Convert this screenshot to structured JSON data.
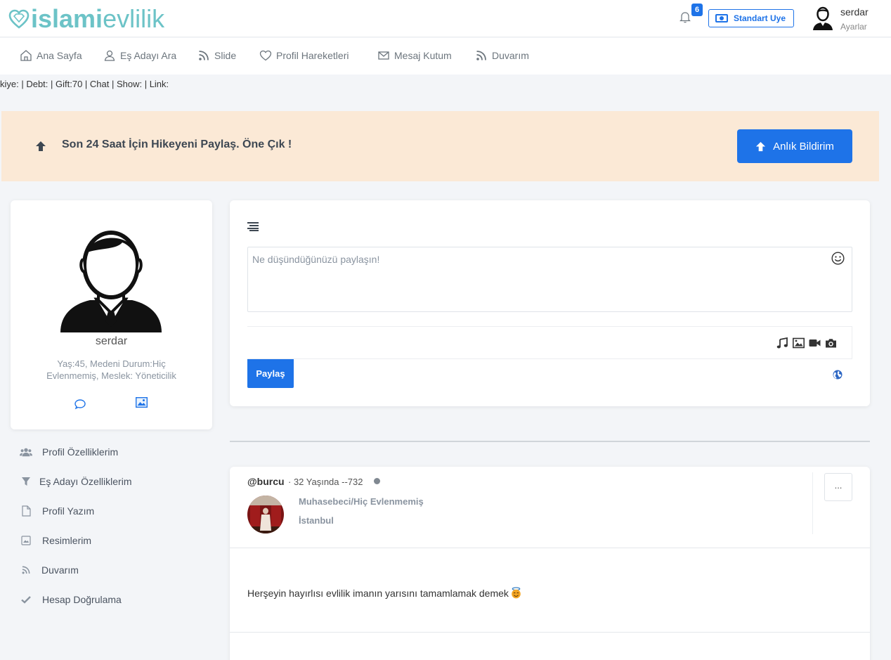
{
  "header": {
    "logo_bold": "islami",
    "logo_light": "evlilik",
    "notification_count": "6",
    "membership_label": "Standart Uye",
    "user_name": "serdar",
    "settings_label": "Ayarlar"
  },
  "nav": {
    "items": [
      {
        "label": "Ana Sayfa",
        "icon": "home-icon"
      },
      {
        "label": "Eş Adayı Ara",
        "icon": "user-icon"
      },
      {
        "label": "Slide",
        "icon": "rss-icon"
      },
      {
        "label": "Profil Hareketleri",
        "icon": "heart-icon"
      },
      {
        "label": "Mesaj Kutum",
        "icon": "envelope-icon"
      },
      {
        "label": "Duvarım",
        "icon": "rss-icon"
      }
    ]
  },
  "debug_line": "kiye: | Debt: | Gift:70 | Chat | Show: | Link:",
  "banner": {
    "text": "Son 24 Saat İçin Hikeyeni Paylaş. Öne Çık !",
    "button_label": "Anlık Bildirim"
  },
  "profile": {
    "name": "serdar",
    "info": "Yaş:45, Medeni Durum:Hiç Evlenmemiş, Meslek: Yöneticilik"
  },
  "side_menu": {
    "items": [
      {
        "label": "Profil Özelliklerim",
        "icon": "users-icon"
      },
      {
        "label": "Eş Adayı Özelliklerim",
        "icon": "filter-icon"
      },
      {
        "label": "Profil Yazım",
        "icon": "file-icon"
      },
      {
        "label": "Resimlerim",
        "icon": "image-icon"
      },
      {
        "label": "Duvarım",
        "icon": "rss-icon"
      },
      {
        "label": "Hesap Doğrulama",
        "icon": "check-icon"
      }
    ]
  },
  "composer": {
    "placeholder": "Ne düşündüğünüzü paylaşın!",
    "share_label": "Paylaş"
  },
  "post": {
    "username": "@burcu",
    "age_line": "· 32 Yaşında --732",
    "job": "Muhasebeci/Hiç Evlenmemiş",
    "city": "İstanbul",
    "more_label": "...",
    "text": "Herşeyin hayırlısı evlilik imanın yarısını tamamlamak demek"
  },
  "colors": {
    "primary": "#1e73e8",
    "logo": "#6cc3c7",
    "banner_bg": "#fbe9d6"
  }
}
